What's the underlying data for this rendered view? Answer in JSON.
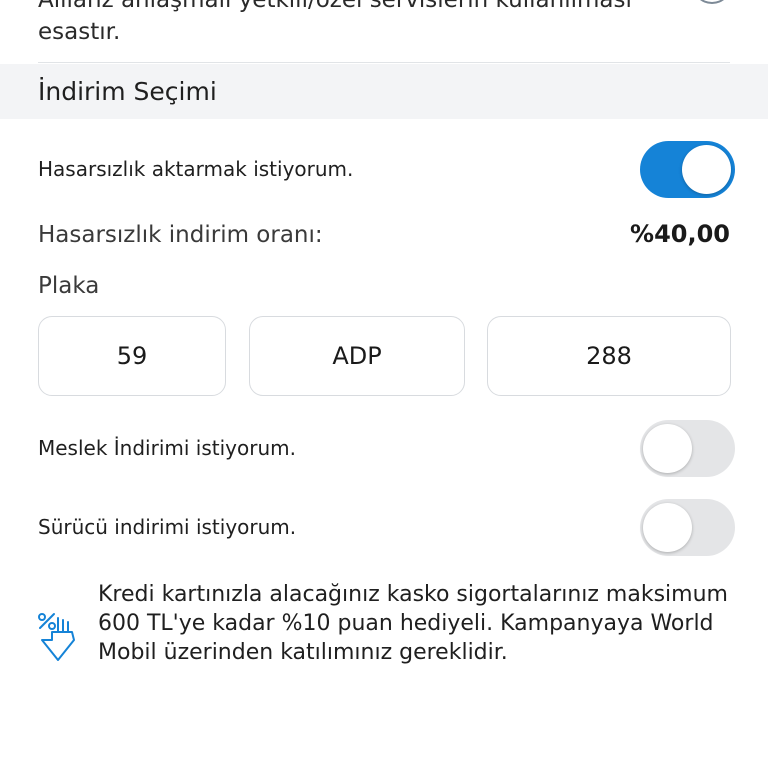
{
  "notice": {
    "text": "Allianz anlaşmalı yetkili/özel servislerin kullanılması esastır."
  },
  "discount_section": {
    "title": "İndirim Seçimi",
    "no_claims_transfer": {
      "label": "Hasarsızlık aktarmak istiyorum.",
      "enabled": true
    },
    "no_claims_rate": {
      "label": "Hasarsızlık indirim oranı:",
      "value": "%40,00"
    },
    "plate": {
      "label": "Plaka",
      "city_code": "59",
      "letters": "ADP",
      "number": "288"
    },
    "profession_discount": {
      "label": "Meslek İndirimi istiyorum.",
      "enabled": false
    },
    "driver_discount": {
      "label": "Sürücü indirimi istiyorum.",
      "enabled": false
    }
  },
  "campaign": {
    "icon": "percent-hand-icon",
    "text": "Kredi kartınızla alacağınız kasko sigortalarınız maksimum 600 TL'ye kadar  %10 puan hediyeli. Kampanyaya World Mobil üzerinden katılımınız gereklidir."
  },
  "colors": {
    "accent": "#1583d7",
    "toggle_off": "#e4e5e7",
    "section_bg": "#f3f4f6"
  }
}
